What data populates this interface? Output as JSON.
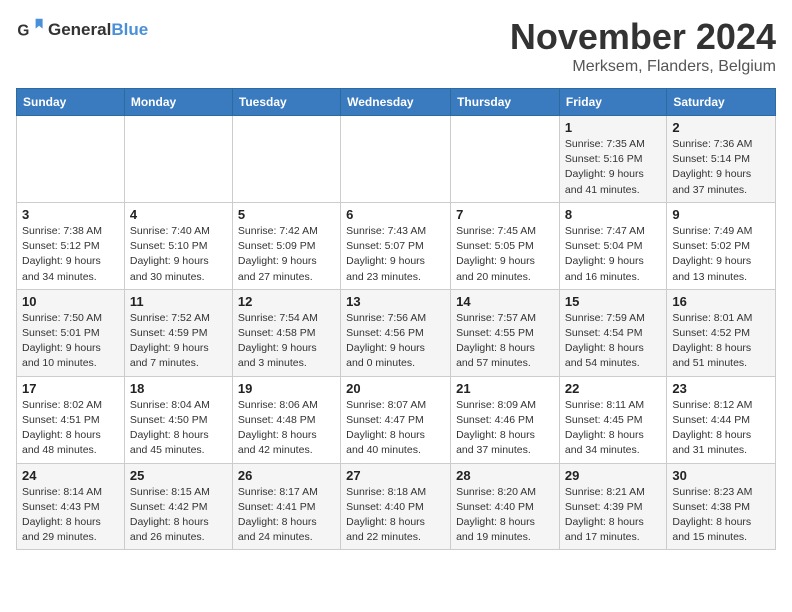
{
  "logo": {
    "general": "General",
    "blue": "Blue"
  },
  "title": "November 2024",
  "location": "Merksem, Flanders, Belgium",
  "weekdays": [
    "Sunday",
    "Monday",
    "Tuesday",
    "Wednesday",
    "Thursday",
    "Friday",
    "Saturday"
  ],
  "weeks": [
    [
      {
        "day": "",
        "info": ""
      },
      {
        "day": "",
        "info": ""
      },
      {
        "day": "",
        "info": ""
      },
      {
        "day": "",
        "info": ""
      },
      {
        "day": "",
        "info": ""
      },
      {
        "day": "1",
        "info": "Sunrise: 7:35 AM\nSunset: 5:16 PM\nDaylight: 9 hours\nand 41 minutes."
      },
      {
        "day": "2",
        "info": "Sunrise: 7:36 AM\nSunset: 5:14 PM\nDaylight: 9 hours\nand 37 minutes."
      }
    ],
    [
      {
        "day": "3",
        "info": "Sunrise: 7:38 AM\nSunset: 5:12 PM\nDaylight: 9 hours\nand 34 minutes."
      },
      {
        "day": "4",
        "info": "Sunrise: 7:40 AM\nSunset: 5:10 PM\nDaylight: 9 hours\nand 30 minutes."
      },
      {
        "day": "5",
        "info": "Sunrise: 7:42 AM\nSunset: 5:09 PM\nDaylight: 9 hours\nand 27 minutes."
      },
      {
        "day": "6",
        "info": "Sunrise: 7:43 AM\nSunset: 5:07 PM\nDaylight: 9 hours\nand 23 minutes."
      },
      {
        "day": "7",
        "info": "Sunrise: 7:45 AM\nSunset: 5:05 PM\nDaylight: 9 hours\nand 20 minutes."
      },
      {
        "day": "8",
        "info": "Sunrise: 7:47 AM\nSunset: 5:04 PM\nDaylight: 9 hours\nand 16 minutes."
      },
      {
        "day": "9",
        "info": "Sunrise: 7:49 AM\nSunset: 5:02 PM\nDaylight: 9 hours\nand 13 minutes."
      }
    ],
    [
      {
        "day": "10",
        "info": "Sunrise: 7:50 AM\nSunset: 5:01 PM\nDaylight: 9 hours\nand 10 minutes."
      },
      {
        "day": "11",
        "info": "Sunrise: 7:52 AM\nSunset: 4:59 PM\nDaylight: 9 hours\nand 7 minutes."
      },
      {
        "day": "12",
        "info": "Sunrise: 7:54 AM\nSunset: 4:58 PM\nDaylight: 9 hours\nand 3 minutes."
      },
      {
        "day": "13",
        "info": "Sunrise: 7:56 AM\nSunset: 4:56 PM\nDaylight: 9 hours\nand 0 minutes."
      },
      {
        "day": "14",
        "info": "Sunrise: 7:57 AM\nSunset: 4:55 PM\nDaylight: 8 hours\nand 57 minutes."
      },
      {
        "day": "15",
        "info": "Sunrise: 7:59 AM\nSunset: 4:54 PM\nDaylight: 8 hours\nand 54 minutes."
      },
      {
        "day": "16",
        "info": "Sunrise: 8:01 AM\nSunset: 4:52 PM\nDaylight: 8 hours\nand 51 minutes."
      }
    ],
    [
      {
        "day": "17",
        "info": "Sunrise: 8:02 AM\nSunset: 4:51 PM\nDaylight: 8 hours\nand 48 minutes."
      },
      {
        "day": "18",
        "info": "Sunrise: 8:04 AM\nSunset: 4:50 PM\nDaylight: 8 hours\nand 45 minutes."
      },
      {
        "day": "19",
        "info": "Sunrise: 8:06 AM\nSunset: 4:48 PM\nDaylight: 8 hours\nand 42 minutes."
      },
      {
        "day": "20",
        "info": "Sunrise: 8:07 AM\nSunset: 4:47 PM\nDaylight: 8 hours\nand 40 minutes."
      },
      {
        "day": "21",
        "info": "Sunrise: 8:09 AM\nSunset: 4:46 PM\nDaylight: 8 hours\nand 37 minutes."
      },
      {
        "day": "22",
        "info": "Sunrise: 8:11 AM\nSunset: 4:45 PM\nDaylight: 8 hours\nand 34 minutes."
      },
      {
        "day": "23",
        "info": "Sunrise: 8:12 AM\nSunset: 4:44 PM\nDaylight: 8 hours\nand 31 minutes."
      }
    ],
    [
      {
        "day": "24",
        "info": "Sunrise: 8:14 AM\nSunset: 4:43 PM\nDaylight: 8 hours\nand 29 minutes."
      },
      {
        "day": "25",
        "info": "Sunrise: 8:15 AM\nSunset: 4:42 PM\nDaylight: 8 hours\nand 26 minutes."
      },
      {
        "day": "26",
        "info": "Sunrise: 8:17 AM\nSunset: 4:41 PM\nDaylight: 8 hours\nand 24 minutes."
      },
      {
        "day": "27",
        "info": "Sunrise: 8:18 AM\nSunset: 4:40 PM\nDaylight: 8 hours\nand 22 minutes."
      },
      {
        "day": "28",
        "info": "Sunrise: 8:20 AM\nSunset: 4:40 PM\nDaylight: 8 hours\nand 19 minutes."
      },
      {
        "day": "29",
        "info": "Sunrise: 8:21 AM\nSunset: 4:39 PM\nDaylight: 8 hours\nand 17 minutes."
      },
      {
        "day": "30",
        "info": "Sunrise: 8:23 AM\nSunset: 4:38 PM\nDaylight: 8 hours\nand 15 minutes."
      }
    ]
  ]
}
